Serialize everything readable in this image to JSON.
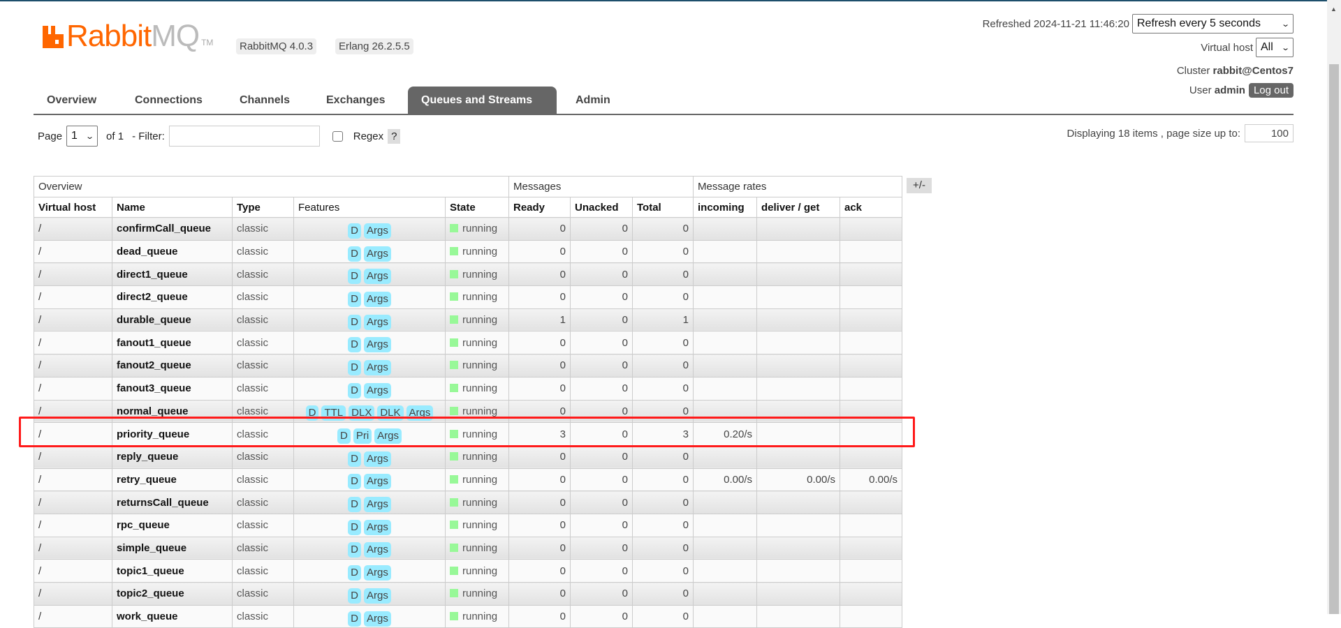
{
  "header": {
    "logo_text_a": "Rabbit",
    "logo_text_b": "MQ",
    "logo_tm": "TM",
    "version_badge": "RabbitMQ 4.0.3",
    "erlang_badge": "Erlang 26.2.5.5",
    "refreshed_label": "Refreshed 2024-11-21 11:46:20",
    "refresh_select": "Refresh every 5 seconds",
    "vhost_label": "Virtual host",
    "vhost_select": "All",
    "cluster_label": "Cluster",
    "cluster_name": "rabbit@Centos7",
    "user_label": "User",
    "user_name": "admin",
    "logout_label": "Log out"
  },
  "tabs": [
    {
      "label": "Overview"
    },
    {
      "label": "Connections"
    },
    {
      "label": "Channels"
    },
    {
      "label": "Exchanges"
    },
    {
      "label": "Queues and Streams",
      "active": true
    },
    {
      "label": "Admin"
    }
  ],
  "pager": {
    "page_label": "Page",
    "page_value": "1",
    "of_label": "of 1",
    "filter_label": "- Filter:",
    "filter_value": "",
    "regex_label": "Regex",
    "regex_checked": false,
    "help_label": "?",
    "display_label": "Displaying 18 items , page size up to:",
    "page_size": "100"
  },
  "table": {
    "groups": [
      "Overview",
      "Messages",
      "Message rates"
    ],
    "columns": [
      "Virtual host",
      "Name",
      "Type",
      "Features",
      "State",
      "Ready",
      "Unacked",
      "Total",
      "incoming",
      "deliver / get",
      "ack"
    ],
    "toggle_label": "+/-",
    "rows": [
      {
        "vhost": "/",
        "name": "confirmCall_queue",
        "type": "classic",
        "features": [
          "D",
          "Args"
        ],
        "state": "running",
        "ready": "0",
        "unacked": "0",
        "total": "0",
        "incoming": "",
        "deliver": "",
        "ack": ""
      },
      {
        "vhost": "/",
        "name": "dead_queue",
        "type": "classic",
        "features": [
          "D",
          "Args"
        ],
        "state": "running",
        "ready": "0",
        "unacked": "0",
        "total": "0",
        "incoming": "",
        "deliver": "",
        "ack": ""
      },
      {
        "vhost": "/",
        "name": "direct1_queue",
        "type": "classic",
        "features": [
          "D",
          "Args"
        ],
        "state": "running",
        "ready": "0",
        "unacked": "0",
        "total": "0",
        "incoming": "",
        "deliver": "",
        "ack": ""
      },
      {
        "vhost": "/",
        "name": "direct2_queue",
        "type": "classic",
        "features": [
          "D",
          "Args"
        ],
        "state": "running",
        "ready": "0",
        "unacked": "0",
        "total": "0",
        "incoming": "",
        "deliver": "",
        "ack": ""
      },
      {
        "vhost": "/",
        "name": "durable_queue",
        "type": "classic",
        "features": [
          "D",
          "Args"
        ],
        "state": "running",
        "ready": "1",
        "unacked": "0",
        "total": "1",
        "incoming": "",
        "deliver": "",
        "ack": ""
      },
      {
        "vhost": "/",
        "name": "fanout1_queue",
        "type": "classic",
        "features": [
          "D",
          "Args"
        ],
        "state": "running",
        "ready": "0",
        "unacked": "0",
        "total": "0",
        "incoming": "",
        "deliver": "",
        "ack": ""
      },
      {
        "vhost": "/",
        "name": "fanout2_queue",
        "type": "classic",
        "features": [
          "D",
          "Args"
        ],
        "state": "running",
        "ready": "0",
        "unacked": "0",
        "total": "0",
        "incoming": "",
        "deliver": "",
        "ack": ""
      },
      {
        "vhost": "/",
        "name": "fanout3_queue",
        "type": "classic",
        "features": [
          "D",
          "Args"
        ],
        "state": "running",
        "ready": "0",
        "unacked": "0",
        "total": "0",
        "incoming": "",
        "deliver": "",
        "ack": ""
      },
      {
        "vhost": "/",
        "name": "normal_queue",
        "type": "classic",
        "features": [
          "D",
          "TTL",
          "DLX",
          "DLK",
          "Args"
        ],
        "state": "running",
        "ready": "0",
        "unacked": "0",
        "total": "0",
        "incoming": "",
        "deliver": "",
        "ack": ""
      },
      {
        "vhost": "/",
        "name": "priority_queue",
        "type": "classic",
        "features": [
          "D",
          "Pri",
          "Args"
        ],
        "state": "running",
        "ready": "3",
        "unacked": "0",
        "total": "3",
        "incoming": "0.20/s",
        "deliver": "",
        "ack": "",
        "highlighted": true
      },
      {
        "vhost": "/",
        "name": "reply_queue",
        "type": "classic",
        "features": [
          "D",
          "Args"
        ],
        "state": "running",
        "ready": "0",
        "unacked": "0",
        "total": "0",
        "incoming": "",
        "deliver": "",
        "ack": ""
      },
      {
        "vhost": "/",
        "name": "retry_queue",
        "type": "classic",
        "features": [
          "D",
          "Args"
        ],
        "state": "running",
        "ready": "0",
        "unacked": "0",
        "total": "0",
        "incoming": "0.00/s",
        "deliver": "0.00/s",
        "ack": "0.00/s"
      },
      {
        "vhost": "/",
        "name": "returnsCall_queue",
        "type": "classic",
        "features": [
          "D",
          "Args"
        ],
        "state": "running",
        "ready": "0",
        "unacked": "0",
        "total": "0",
        "incoming": "",
        "deliver": "",
        "ack": ""
      },
      {
        "vhost": "/",
        "name": "rpc_queue",
        "type": "classic",
        "features": [
          "D",
          "Args"
        ],
        "state": "running",
        "ready": "0",
        "unacked": "0",
        "total": "0",
        "incoming": "",
        "deliver": "",
        "ack": ""
      },
      {
        "vhost": "/",
        "name": "simple_queue",
        "type": "classic",
        "features": [
          "D",
          "Args"
        ],
        "state": "running",
        "ready": "0",
        "unacked": "0",
        "total": "0",
        "incoming": "",
        "deliver": "",
        "ack": ""
      },
      {
        "vhost": "/",
        "name": "topic1_queue",
        "type": "classic",
        "features": [
          "D",
          "Args"
        ],
        "state": "running",
        "ready": "0",
        "unacked": "0",
        "total": "0",
        "incoming": "",
        "deliver": "",
        "ack": ""
      },
      {
        "vhost": "/",
        "name": "topic2_queue",
        "type": "classic",
        "features": [
          "D",
          "Args"
        ],
        "state": "running",
        "ready": "0",
        "unacked": "0",
        "total": "0",
        "incoming": "",
        "deliver": "",
        "ack": ""
      },
      {
        "vhost": "/",
        "name": "work_queue",
        "type": "classic",
        "features": [
          "D",
          "Args"
        ],
        "state": "running",
        "ready": "0",
        "unacked": "0",
        "total": "0",
        "incoming": "",
        "deliver": "",
        "ack": ""
      }
    ]
  },
  "colors": {
    "brand": "#ff6600",
    "feature_badge": "#99ebff",
    "running": "#98f898",
    "highlight_box": "#ff1a1a",
    "active_tab": "#666666"
  }
}
